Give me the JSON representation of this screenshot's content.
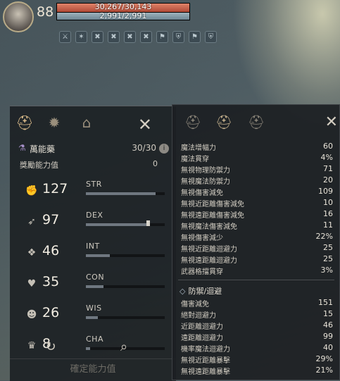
{
  "player": {
    "level": "88",
    "hp_text": "30,267/30,143",
    "mp_text": "2,991/2,991",
    "hp_fill": 1.0,
    "mp_fill": 1.0
  },
  "buffs": [
    "⚔",
    "✶",
    "✖",
    "✖",
    "✖",
    "✖",
    "⚑",
    "⛨",
    "⚑",
    "⛨"
  ],
  "left_panel": {
    "tabs": [
      "helmet-icon",
      "star-burst-icon",
      "house-icon"
    ],
    "close": "✕",
    "potion": {
      "name": "萬能藥",
      "count": "30/30",
      "info": "i"
    },
    "bonus": {
      "label": "獎勵能力值",
      "value": "0"
    },
    "stats": [
      {
        "icon": "arm-icon",
        "glyph": "✊",
        "value": "127",
        "name": "STR",
        "fill": 0.88
      },
      {
        "icon": "foot-icon",
        "glyph": "➶",
        "value": "97",
        "name": "DEX",
        "fill": 0.8
      },
      {
        "icon": "book-icon",
        "glyph": "❖",
        "value": "46",
        "name": "INT",
        "fill": 0.3
      },
      {
        "icon": "heart-icon",
        "glyph": "♥",
        "value": "35",
        "name": "CON",
        "fill": 0.22
      },
      {
        "icon": "head-icon",
        "glyph": "☻",
        "value": "26",
        "name": "WIS",
        "fill": 0.15
      },
      {
        "icon": "crown-icon",
        "glyph": "♛",
        "value": "8",
        "name": "CHA",
        "fill": 0.05
      }
    ],
    "reset_icon": "↻",
    "search_icon": "⌕",
    "confirm_label": "確定能力值"
  },
  "right_panel": {
    "tabs": [
      "helmet-icon",
      "helmet-plus-icon",
      "helmet-minus-icon"
    ],
    "close": "✕",
    "rows": [
      {
        "label": "魔法增幅力",
        "value": "60"
      },
      {
        "label": "魔法貫穿",
        "value": "4%"
      },
      {
        "label": "無視物理防禦力",
        "value": "71"
      },
      {
        "label": "無視魔法防禦力",
        "value": "20"
      },
      {
        "label": "無視傷害減免",
        "value": "109"
      },
      {
        "label": "無視近距離傷害減免",
        "value": "10"
      },
      {
        "label": "無視遠距離傷害減免",
        "value": "16"
      },
      {
        "label": "無視魔法傷害減免",
        "value": "11"
      },
      {
        "label": "無視傷害減少",
        "value": "22%"
      },
      {
        "label": "無視近距離迴避力",
        "value": "25"
      },
      {
        "label": "無視遠距離迴避力",
        "value": "25"
      },
      {
        "label": "武器格擋貫穿",
        "value": "3%"
      }
    ],
    "section_title": "防禦/迴避",
    "defense_rows": [
      {
        "label": "傷害減免",
        "value": "151"
      },
      {
        "label": "絕對迴避力",
        "value": "15"
      },
      {
        "label": "近距離迴避力",
        "value": "46"
      },
      {
        "label": "遠距離迴避力",
        "value": "99"
      },
      {
        "label": "機率魔法迴避力",
        "value": "40"
      },
      {
        "label": "無視近距離暴擊",
        "value": "29%"
      },
      {
        "label": "無視遠距離暴擊",
        "value": "21%"
      }
    ]
  }
}
